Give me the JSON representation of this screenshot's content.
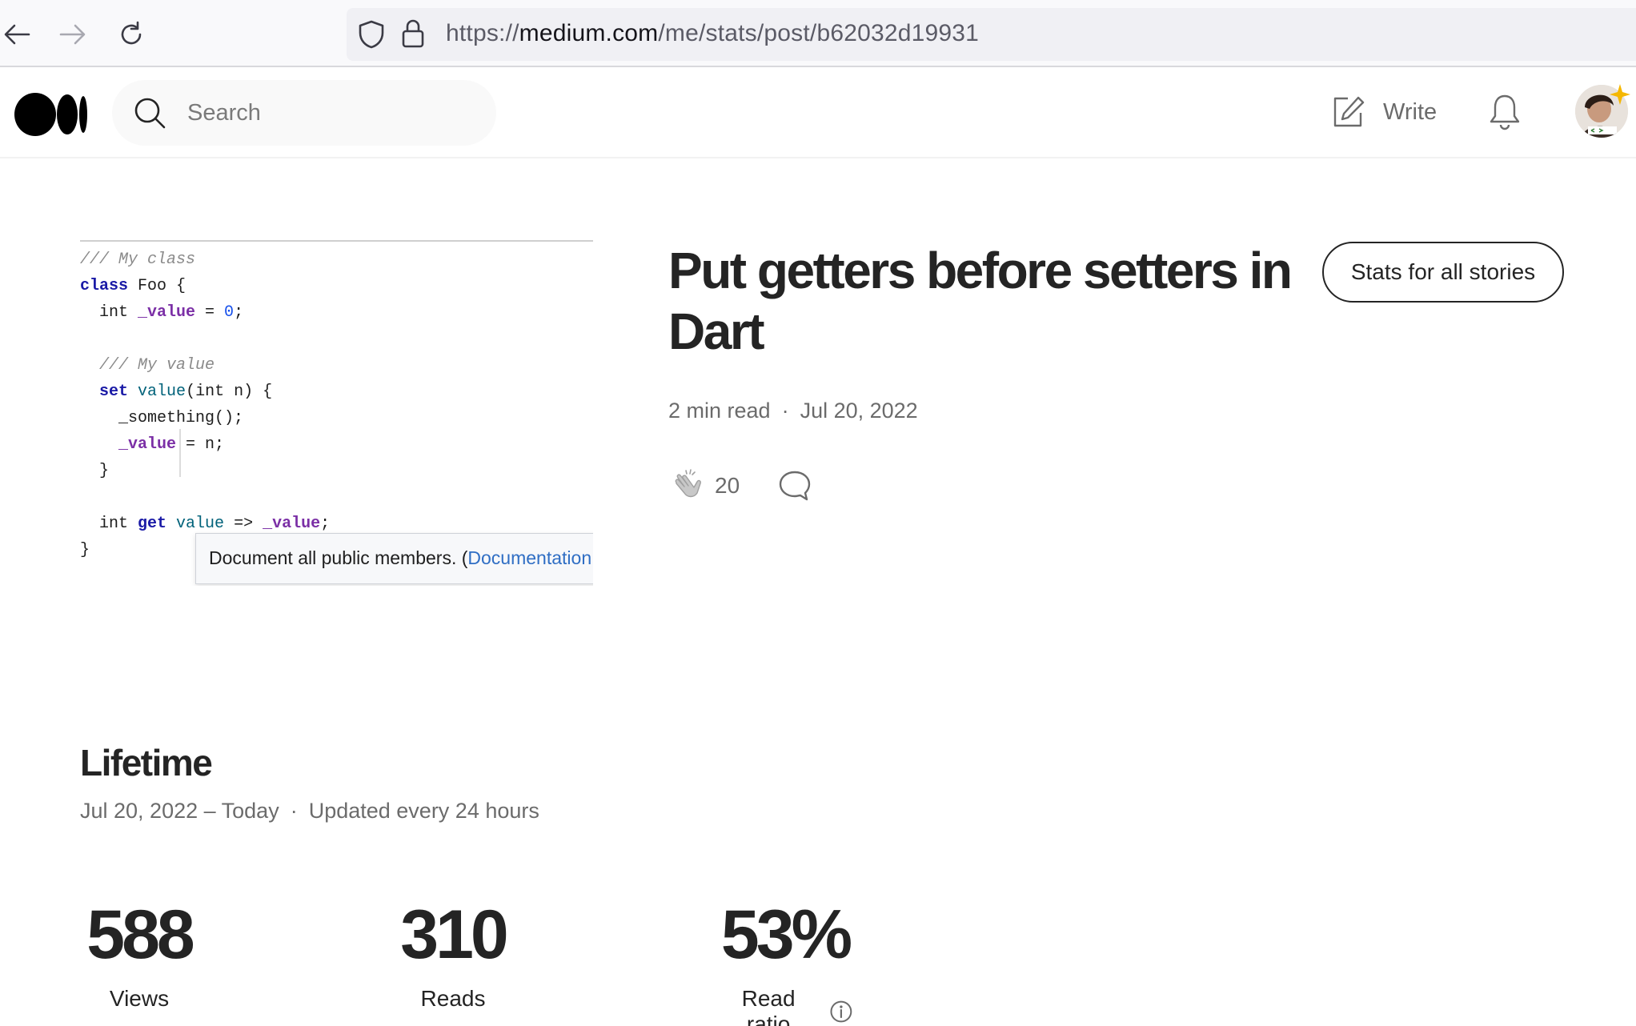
{
  "browser": {
    "url_prefix": "https://",
    "url_host": "medium.com",
    "url_path": "/me/stats/post/b62032d19931"
  },
  "header": {
    "search_placeholder": "Search",
    "write_label": "Write"
  },
  "code_preview": {
    "tooltip_text": "Document all public members. (",
    "tooltip_link": "Documentation"
  },
  "article": {
    "title": "Put getters before setters in Dart",
    "stats_all_label": "Stats for all stories",
    "read_time": "2 min read",
    "date": "Jul 20, 2022",
    "claps": "20"
  },
  "lifetime": {
    "title": "Lifetime",
    "range": "Jul 20, 2022 – Today",
    "update_note": "Updated every 24 hours",
    "stats": [
      {
        "value": "588",
        "label": "Views"
      },
      {
        "value": "310",
        "label": "Reads"
      },
      {
        "value": "53%",
        "label": "Read ratio"
      }
    ]
  },
  "icons": {
    "back": "arrow-left-icon",
    "forward": "arrow-right-icon",
    "reload": "reload-icon",
    "shield": "shield-icon",
    "lock": "lock-icon",
    "search": "search-icon",
    "write": "edit-icon",
    "notifications": "bell-icon",
    "clap": "clap-icon",
    "comment": "comment-icon",
    "info": "info-icon"
  }
}
